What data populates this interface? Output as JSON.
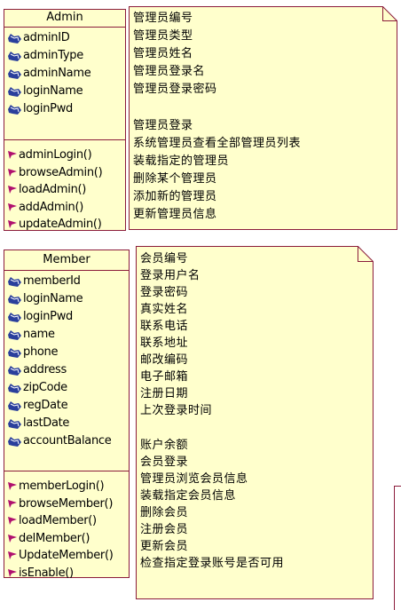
{
  "admin_class": {
    "name": "Admin",
    "attributes": [
      "adminID",
      "adminType",
      "adminName",
      "loginName",
      "loginPwd"
    ],
    "operations": [
      "adminLogin()",
      "browseAdmin()",
      "loadAdmin()",
      "addAdmin()",
      "updateAdmin()"
    ],
    "note": {
      "attribute_descriptions": [
        "管理员编号",
        "管理员类型",
        "管理员姓名",
        "管理员登录名",
        "管理员登录密码"
      ],
      "operation_descriptions": [
        "管理员登录",
        "系统管理员查看全部管理员列表",
        "装载指定的管理员",
        "删除某个管理员",
        "添加新的管理员",
        "更新管理员信息"
      ]
    }
  },
  "member_class": {
    "name": "Member",
    "attributes": [
      "memberId",
      "loginName",
      "loginPwd",
      "name",
      "phone",
      "address",
      "zipCode",
      "regDate",
      "lastDate",
      "accountBalance"
    ],
    "operations": [
      "memberLogin()",
      "browseMember()",
      "loadMember()",
      "delMember()",
      "UpdateMember()",
      "isEnable()"
    ],
    "note": {
      "attribute_descriptions": [
        "会员编号",
        "登录用户名",
        "登录密码",
        "真实姓名",
        "联系电话",
        "联系地址",
        "邮改编码",
        "电子邮箱",
        "注册日期",
        "上次登录时间"
      ],
      "operation_descriptions": [
        "账户余额",
        "会员登录",
        "管理员浏览会员信息",
        "装载指定会员信息",
        "删除会员",
        "注册会员",
        "更新会员",
        "检查指定登录账号是否可用"
      ]
    }
  },
  "icons": {
    "attribute": "attribute-icon",
    "operation": "operation-icon"
  },
  "colors": {
    "class_fill": "#ffffcc",
    "class_border": "#8b1c3b",
    "attribute_icon": "#2a3f9c",
    "operation_icon": "#b0106e"
  }
}
